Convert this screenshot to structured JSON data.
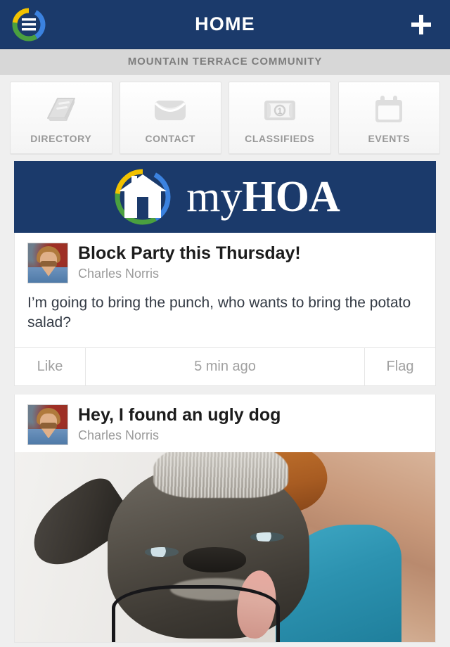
{
  "header": {
    "title": "HOME",
    "menu_icon": "hamburger-menu-icon",
    "add_icon": "plus-icon",
    "background_color": "#1b3a6b"
  },
  "community_bar": {
    "name": "MOUNTAIN TERRACE COMMUNITY",
    "background_color": "#d7d7d7",
    "text_color": "#7d7d7d"
  },
  "nav_tiles": [
    {
      "label": "DIRECTORY",
      "icon": "book-icon"
    },
    {
      "label": "CONTACT",
      "icon": "envelope-icon"
    },
    {
      "label": "CLASSIFIEDS",
      "icon": "banknote-icon"
    },
    {
      "label": "EVENTS",
      "icon": "calendar-icon"
    }
  ],
  "banner": {
    "brand_prefix": "my",
    "brand_suffix": "HOA",
    "logo_icon": "house-in-ring-logo",
    "background_color": "#1b3a6b",
    "ring_colors": {
      "yellow": "#f2c200",
      "blue": "#3b82e0",
      "green": "#4aa03f"
    }
  },
  "posts": [
    {
      "title": "Block Party this Thursday!",
      "author": "Charles Norris",
      "avatar_icon": "user-avatar-photo",
      "body": "I’m going to bring the punch, who wants to bring the potato salad?",
      "actions": {
        "like_label": "Like",
        "timestamp": "5 min ago",
        "flag_label": "Flag"
      },
      "has_photo": false
    },
    {
      "title": "Hey, I found an ugly dog",
      "author": "Charles Norris",
      "avatar_icon": "user-avatar-photo",
      "body": "",
      "photo_alt": "ugly-dog-photo",
      "has_photo": true
    }
  ]
}
